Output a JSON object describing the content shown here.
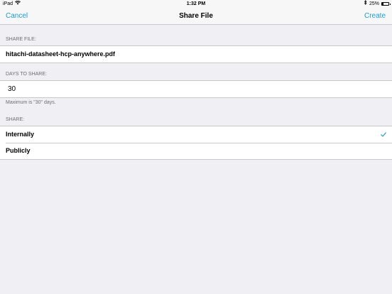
{
  "status_bar": {
    "device": "iPad",
    "time": "1:32 PM",
    "battery_percent": "25%",
    "battery_level": 0.25
  },
  "nav": {
    "cancel_label": "Cancel",
    "title": "Share File",
    "create_label": "Create"
  },
  "share_file": {
    "header": "SHARE FILE:",
    "filename": "hitachi-datasheet-hcp-anywhere.pdf"
  },
  "days": {
    "header": "DAYS TO SHARE:",
    "value": "30",
    "note": "Maximum is \"30\" days."
  },
  "share": {
    "header": "SHARE:",
    "options": [
      {
        "label": "Internally",
        "selected": true
      },
      {
        "label": "Publicly",
        "selected": false
      }
    ]
  },
  "colors": {
    "accent": "#1a9bd7",
    "background": "#efeff4"
  }
}
